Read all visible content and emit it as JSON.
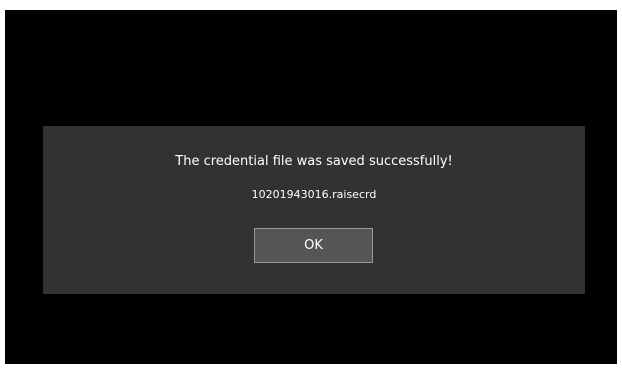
{
  "dialog": {
    "message": "The credential file was saved successfully!",
    "filename": "10201943016.raisecrd",
    "ok_label": "OK"
  },
  "colors": {
    "background": "#000000",
    "dialog_background": "#323232",
    "button_background": "#555555",
    "button_border": "#9a9a9a",
    "text": "#ffffff"
  }
}
